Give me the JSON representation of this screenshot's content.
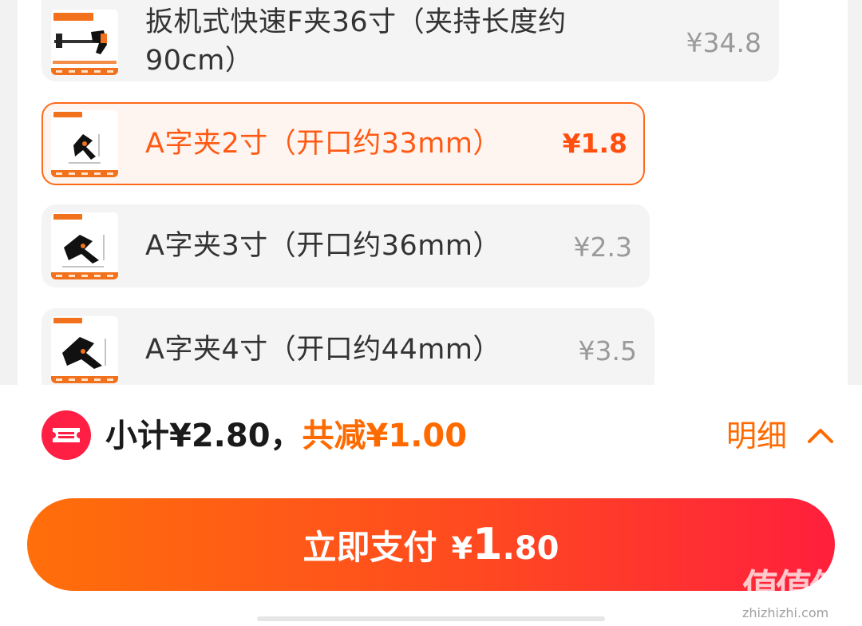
{
  "sku_list": [
    {
      "name_line1": "扳机式快速F夹36寸（夹持长度约",
      "name_line2": "90cm）",
      "price": "¥34.8",
      "selected": false,
      "thumb_text": "扳机式快速F夹"
    },
    {
      "name_line1": "A字夹2寸（开口约33mm）",
      "name_line2": "",
      "price": "¥1.8",
      "selected": true,
      "thumb_text": "A字夹工具"
    },
    {
      "name_line1": "A字夹3寸（开口约36mm）",
      "name_line2": "",
      "price": "¥2.3",
      "selected": false,
      "thumb_text": "A字夹工具"
    },
    {
      "name_line1": "A字夹4寸（开口约44mm）",
      "name_line2": "",
      "price": "¥3.5",
      "selected": false,
      "thumb_text": "A字夹工具"
    }
  ],
  "summary": {
    "subtotal_text": "小计¥2.80，",
    "discount_text": "共减¥1.00",
    "detail_label": "明细"
  },
  "pay_button": {
    "label": "立即支付",
    "currency": "¥",
    "amount_int": "1",
    "amount_dec": ".80"
  },
  "watermark": {
    "chars": "值值值",
    "domain": "zhizhizhi.com"
  },
  "colors": {
    "accent": "#ff6a00",
    "selected_border": "#ff6a1a",
    "badge_red": "#ff1f44"
  },
  "icons": [
    "coupon-icon",
    "chevron-up-icon",
    "clamp-thumbnail"
  ]
}
